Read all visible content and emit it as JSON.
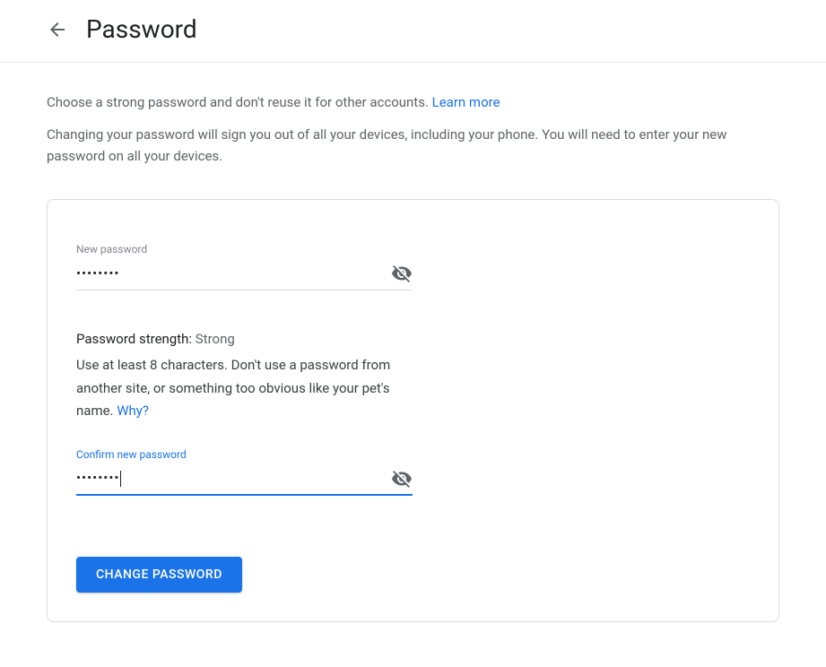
{
  "header": {
    "title": "Password"
  },
  "intro": {
    "line1": "Choose a strong password and don't reuse it for other accounts. ",
    "learn_more": "Learn more",
    "line2": "Changing your password will sign you out of all your devices, including your phone. You will need to enter your new password on all your devices."
  },
  "form": {
    "new_password": {
      "label": "New password",
      "value": "••••••••"
    },
    "strength": {
      "label": "Password strength: ",
      "value": "Strong",
      "help_text": "Use at least 8 characters. Don't use a password from another site, or something too obvious like your pet's name. ",
      "why_link": "Why?"
    },
    "confirm_password": {
      "label": "Confirm new password",
      "value": "••••••••"
    },
    "submit_label": "CHANGE PASSWORD"
  }
}
